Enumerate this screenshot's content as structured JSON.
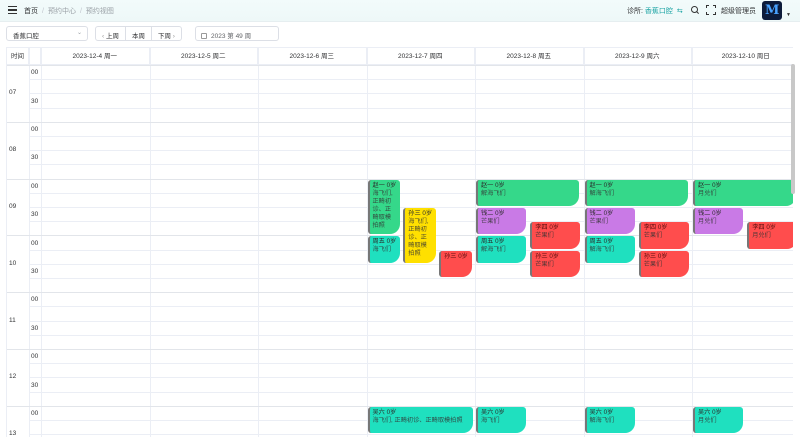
{
  "header": {
    "breadcrumb": [
      "首页",
      "预约中心",
      "预约视图"
    ],
    "clinic_label": "诊所:",
    "clinic_value": "香蕉口腔",
    "user_name": "超级管理员"
  },
  "toolbar": {
    "clinic_select": "香蕉口腔",
    "prev_week": "上周",
    "this_week": "本周",
    "next_week": "下周",
    "week_value": "2023 第 49 周"
  },
  "calendar": {
    "time_col_label": "时间",
    "days": [
      "2023-12-4 周一",
      "2023-12-5 周二",
      "2023-12-6 周三",
      "2023-12-7 周四",
      "2023-12-8 周五",
      "2023-12-9 周六",
      "2023-12-10 周日"
    ],
    "hours": [
      "07",
      "08",
      "09",
      "10",
      "11",
      "12",
      "13"
    ],
    "minutes": [
      "00",
      "30"
    ]
  },
  "events": [
    {
      "id": "e1",
      "title": "赵一 0岁",
      "desc": "海飞们, 正畸初诊、正畸取模拍照",
      "color": "#35d88a"
    },
    {
      "id": "e2",
      "title": "孙三 0岁",
      "desc": "海飞们, 正畸初诊、正畸取模拍照",
      "color": "#ffe000"
    },
    {
      "id": "e3",
      "title": "周五 0岁",
      "desc": "海飞们",
      "color": "#1fe0bf"
    },
    {
      "id": "e4",
      "title": "孙三 0岁",
      "desc": "",
      "color": "#ff4d4d"
    },
    {
      "id": "e5",
      "title": "赵一 0岁",
      "desc": "解海飞们",
      "color": "#35d88a"
    },
    {
      "id": "e6",
      "title": "钱二 0岁",
      "desc": "芒果们",
      "color": "#c97ae6"
    },
    {
      "id": "e7",
      "title": "李四 0岁",
      "desc": "芒果们",
      "color": "#ff4d4d"
    },
    {
      "id": "e8",
      "title": "周五 0岁",
      "desc": "解海飞们",
      "color": "#1fe0bf"
    },
    {
      "id": "e9",
      "title": "孙三 0岁",
      "desc": "芒果们",
      "color": "#ff4d4d"
    },
    {
      "id": "e10",
      "title": "赵一 0岁",
      "desc": "解海飞们",
      "color": "#35d88a"
    },
    {
      "id": "e11",
      "title": "钱二 0岁",
      "desc": "芒果们",
      "color": "#c97ae6"
    },
    {
      "id": "e12",
      "title": "李四 0岁",
      "desc": "芒果们",
      "color": "#ff4d4d"
    },
    {
      "id": "e13",
      "title": "周五 0岁",
      "desc": "解海飞们",
      "color": "#1fe0bf"
    },
    {
      "id": "e14",
      "title": "孙三 0岁",
      "desc": "芒果们",
      "color": "#ff4d4d"
    },
    {
      "id": "e15",
      "title": "赵一 0岁",
      "desc": "月兑们",
      "color": "#35d88a"
    },
    {
      "id": "e16",
      "title": "钱二 0岁",
      "desc": "月兑们",
      "color": "#c97ae6"
    },
    {
      "id": "e17",
      "title": "李四 0岁",
      "desc": "月兑们",
      "color": "#ff4d4d"
    },
    {
      "id": "e18",
      "title": "吴六 0岁",
      "desc": "海飞们, 正畸初诊、正畸取模拍照",
      "color": "#1fe0bf"
    },
    {
      "id": "e19",
      "title": "吴六 0岁",
      "desc": "海飞们",
      "color": "#1fe0bf"
    },
    {
      "id": "e20",
      "title": "吴六 0岁",
      "desc": "解海飞们",
      "color": "#1fe0bf"
    },
    {
      "id": "e21",
      "title": "吴六 0岁",
      "desc": "月兑们",
      "color": "#1fe0bf"
    }
  ]
}
